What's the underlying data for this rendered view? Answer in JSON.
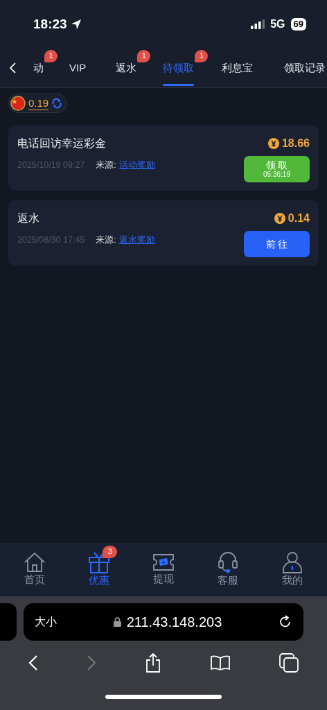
{
  "status_bar": {
    "time": "18:23",
    "network": "5G",
    "battery": "69"
  },
  "tabs": [
    {
      "label": "动",
      "badge": "1",
      "selected": false
    },
    {
      "label": "VIP",
      "selected": false
    },
    {
      "label": "返水",
      "badge": "1",
      "selected": false
    },
    {
      "label": "待领取",
      "badge": "1",
      "selected": true
    },
    {
      "label": "利息宝",
      "selected": false
    },
    {
      "label": "领取记录",
      "selected": false
    }
  ],
  "balance": {
    "amount": "0.19"
  },
  "rewards": [
    {
      "title": "电话回访幸运彩金",
      "amount": "18.66",
      "date": "2025/10/19 09:27",
      "source_label": "来源:",
      "source": "活动奖励",
      "button": {
        "kind": "claim",
        "label": "领 取",
        "countdown": "05:36:19"
      }
    },
    {
      "title": "返水",
      "amount": "0.14",
      "date": "2025/08/30 17:45",
      "source_label": "来源:",
      "source": "返水奖励",
      "button": {
        "kind": "go",
        "label": "前 往"
      }
    }
  ],
  "bottom_nav": [
    {
      "kind": "home",
      "label": "首页",
      "selected": false
    },
    {
      "kind": "gift",
      "label": "优惠",
      "badge": "3",
      "selected": true
    },
    {
      "kind": "withdraw",
      "label": "提现",
      "selected": false
    },
    {
      "kind": "support",
      "label": "客服",
      "selected": false
    },
    {
      "kind": "profile",
      "label": "我的",
      "selected": false
    }
  ],
  "browser": {
    "text_size": "大小",
    "address": "211.43.148.203"
  }
}
